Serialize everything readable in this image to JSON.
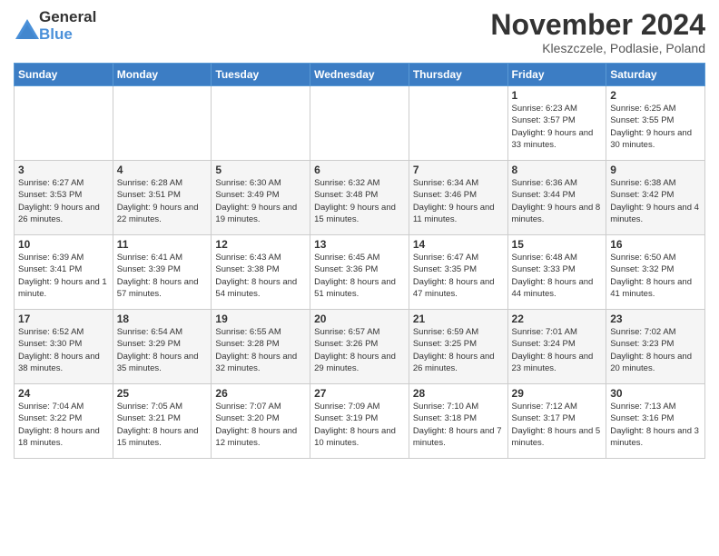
{
  "header": {
    "logo_general": "General",
    "logo_blue": "Blue",
    "month_title": "November 2024",
    "location": "Kleszczele, Podlasie, Poland"
  },
  "weekdays": [
    "Sunday",
    "Monday",
    "Tuesday",
    "Wednesday",
    "Thursday",
    "Friday",
    "Saturday"
  ],
  "weeks": [
    [
      {
        "day": "",
        "info": ""
      },
      {
        "day": "",
        "info": ""
      },
      {
        "day": "",
        "info": ""
      },
      {
        "day": "",
        "info": ""
      },
      {
        "day": "",
        "info": ""
      },
      {
        "day": "1",
        "info": "Sunrise: 6:23 AM\nSunset: 3:57 PM\nDaylight: 9 hours and 33 minutes."
      },
      {
        "day": "2",
        "info": "Sunrise: 6:25 AM\nSunset: 3:55 PM\nDaylight: 9 hours and 30 minutes."
      }
    ],
    [
      {
        "day": "3",
        "info": "Sunrise: 6:27 AM\nSunset: 3:53 PM\nDaylight: 9 hours and 26 minutes."
      },
      {
        "day": "4",
        "info": "Sunrise: 6:28 AM\nSunset: 3:51 PM\nDaylight: 9 hours and 22 minutes."
      },
      {
        "day": "5",
        "info": "Sunrise: 6:30 AM\nSunset: 3:49 PM\nDaylight: 9 hours and 19 minutes."
      },
      {
        "day": "6",
        "info": "Sunrise: 6:32 AM\nSunset: 3:48 PM\nDaylight: 9 hours and 15 minutes."
      },
      {
        "day": "7",
        "info": "Sunrise: 6:34 AM\nSunset: 3:46 PM\nDaylight: 9 hours and 11 minutes."
      },
      {
        "day": "8",
        "info": "Sunrise: 6:36 AM\nSunset: 3:44 PM\nDaylight: 9 hours and 8 minutes."
      },
      {
        "day": "9",
        "info": "Sunrise: 6:38 AM\nSunset: 3:42 PM\nDaylight: 9 hours and 4 minutes."
      }
    ],
    [
      {
        "day": "10",
        "info": "Sunrise: 6:39 AM\nSunset: 3:41 PM\nDaylight: 9 hours and 1 minute."
      },
      {
        "day": "11",
        "info": "Sunrise: 6:41 AM\nSunset: 3:39 PM\nDaylight: 8 hours and 57 minutes."
      },
      {
        "day": "12",
        "info": "Sunrise: 6:43 AM\nSunset: 3:38 PM\nDaylight: 8 hours and 54 minutes."
      },
      {
        "day": "13",
        "info": "Sunrise: 6:45 AM\nSunset: 3:36 PM\nDaylight: 8 hours and 51 minutes."
      },
      {
        "day": "14",
        "info": "Sunrise: 6:47 AM\nSunset: 3:35 PM\nDaylight: 8 hours and 47 minutes."
      },
      {
        "day": "15",
        "info": "Sunrise: 6:48 AM\nSunset: 3:33 PM\nDaylight: 8 hours and 44 minutes."
      },
      {
        "day": "16",
        "info": "Sunrise: 6:50 AM\nSunset: 3:32 PM\nDaylight: 8 hours and 41 minutes."
      }
    ],
    [
      {
        "day": "17",
        "info": "Sunrise: 6:52 AM\nSunset: 3:30 PM\nDaylight: 8 hours and 38 minutes."
      },
      {
        "day": "18",
        "info": "Sunrise: 6:54 AM\nSunset: 3:29 PM\nDaylight: 8 hours and 35 minutes."
      },
      {
        "day": "19",
        "info": "Sunrise: 6:55 AM\nSunset: 3:28 PM\nDaylight: 8 hours and 32 minutes."
      },
      {
        "day": "20",
        "info": "Sunrise: 6:57 AM\nSunset: 3:26 PM\nDaylight: 8 hours and 29 minutes."
      },
      {
        "day": "21",
        "info": "Sunrise: 6:59 AM\nSunset: 3:25 PM\nDaylight: 8 hours and 26 minutes."
      },
      {
        "day": "22",
        "info": "Sunrise: 7:01 AM\nSunset: 3:24 PM\nDaylight: 8 hours and 23 minutes."
      },
      {
        "day": "23",
        "info": "Sunrise: 7:02 AM\nSunset: 3:23 PM\nDaylight: 8 hours and 20 minutes."
      }
    ],
    [
      {
        "day": "24",
        "info": "Sunrise: 7:04 AM\nSunset: 3:22 PM\nDaylight: 8 hours and 18 minutes."
      },
      {
        "day": "25",
        "info": "Sunrise: 7:05 AM\nSunset: 3:21 PM\nDaylight: 8 hours and 15 minutes."
      },
      {
        "day": "26",
        "info": "Sunrise: 7:07 AM\nSunset: 3:20 PM\nDaylight: 8 hours and 12 minutes."
      },
      {
        "day": "27",
        "info": "Sunrise: 7:09 AM\nSunset: 3:19 PM\nDaylight: 8 hours and 10 minutes."
      },
      {
        "day": "28",
        "info": "Sunrise: 7:10 AM\nSunset: 3:18 PM\nDaylight: 8 hours and 7 minutes."
      },
      {
        "day": "29",
        "info": "Sunrise: 7:12 AM\nSunset: 3:17 PM\nDaylight: 8 hours and 5 minutes."
      },
      {
        "day": "30",
        "info": "Sunrise: 7:13 AM\nSunset: 3:16 PM\nDaylight: 8 hours and 3 minutes."
      }
    ]
  ]
}
